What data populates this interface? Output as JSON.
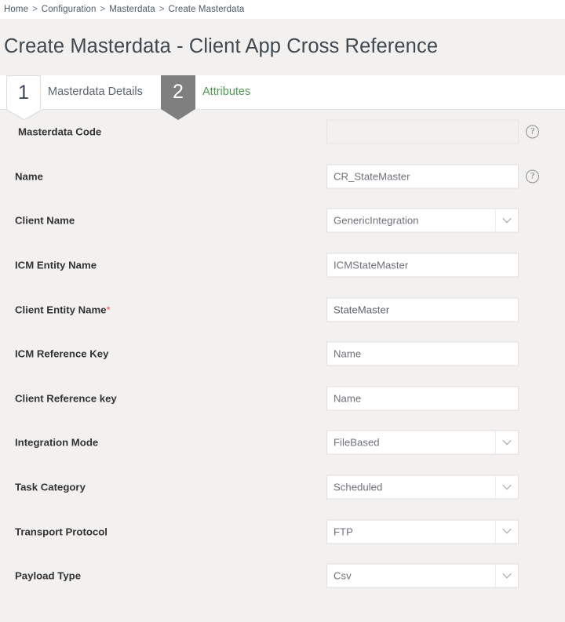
{
  "breadcrumb": {
    "separator": ">",
    "items": [
      "Home",
      "Configuration",
      "Masterdata",
      "Create Masterdata"
    ]
  },
  "page": {
    "title": "Create Masterdata - Client App Cross Reference"
  },
  "tabs": [
    {
      "number": "1",
      "label": "Masterdata Details",
      "state": "active"
    },
    {
      "number": "2",
      "label": "Attributes",
      "state": "inactive"
    }
  ],
  "colors": {
    "page_background": "#f2f1f0",
    "tab_inactive_gray": "#7f7f7f",
    "tab_link_green": "#4e9a51",
    "required_asterisk_red": "#e8504a",
    "field_border": "#e0dfde"
  },
  "icons": {
    "help": "?",
    "dropdown": "chevron-down"
  },
  "form": {
    "fields": [
      {
        "label": "Masterdata Code",
        "type": "text",
        "value": "",
        "placeholder": "",
        "disabled": true,
        "required": false,
        "help": true
      },
      {
        "label": "Name",
        "type": "text",
        "value": "CR_StateMaster",
        "placeholder": "",
        "disabled": false,
        "required": false,
        "help": true
      },
      {
        "label": "Client Name",
        "type": "select",
        "value": "GenericIntegration",
        "placeholder": "",
        "disabled": false,
        "required": false,
        "help": false
      },
      {
        "label": "ICM Entity Name",
        "type": "text",
        "value": "ICMStateMaster",
        "placeholder": "",
        "disabled": false,
        "required": false,
        "help": false
      },
      {
        "label": "Client Entity Name",
        "type": "text",
        "value": "StateMaster",
        "placeholder": "",
        "disabled": false,
        "required": true,
        "help": false
      },
      {
        "label": "ICM Reference Key",
        "type": "text",
        "value": "Name",
        "placeholder": "Name",
        "disabled": false,
        "required": false,
        "help": false
      },
      {
        "label": "Client Reference key",
        "type": "text",
        "value": "Name",
        "placeholder": "Name",
        "disabled": false,
        "required": false,
        "help": false
      },
      {
        "label": "Integration Mode",
        "type": "select",
        "value": "FileBased",
        "placeholder": "",
        "disabled": false,
        "required": false,
        "help": false
      },
      {
        "label": "Task Category",
        "type": "select",
        "value": "Scheduled",
        "placeholder": "",
        "disabled": false,
        "required": false,
        "help": false
      },
      {
        "label": "Transport Protocol",
        "type": "select",
        "value": "FTP",
        "placeholder": "",
        "disabled": false,
        "required": false,
        "help": false
      },
      {
        "label": "Payload Type",
        "type": "select",
        "value": "Csv",
        "placeholder": "",
        "disabled": false,
        "required": false,
        "help": false
      }
    ]
  }
}
